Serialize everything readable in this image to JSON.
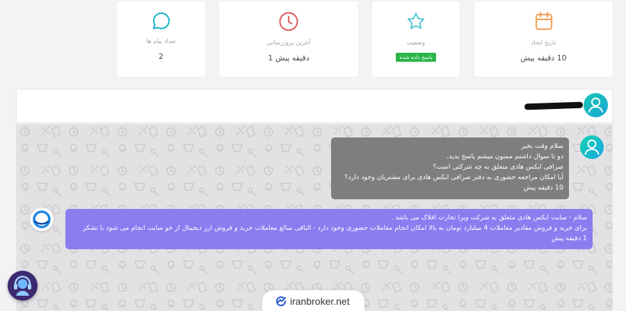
{
  "stats": [
    {
      "label": "تعداد پیام ها",
      "value": "2",
      "icon": "chat-bubble-icon",
      "color": "#22b7c9"
    },
    {
      "label": "آخرین بروزرسانی",
      "value": "دقیقه پیش 1",
      "icon": "clock-icon",
      "color": "#e06565"
    },
    {
      "label": "وضعیت",
      "badge": "پاسخ داده شده",
      "icon": "star-icon",
      "color": "#53c6d6",
      "badge_color": "#2bb44a"
    },
    {
      "label": "تاریخ ایجاد",
      "value": "10 دقیقه پیش",
      "icon": "calendar-icon",
      "color": "#f5a55c"
    }
  ],
  "messages": [
    {
      "sender": "user",
      "lines": [
        "سلام وقت بخیر",
        "دو تا سوال داشتم ممنون میشم پاسخ بدید.",
        "صرافی ایکس هادی متعلق به چه شرکتی است؟",
        "آیا امکان مراجعه حضوری به دفتر صرافی ایکس هادی برای مشتریان وجود دارد؟",
        "10 دقیقه پیش"
      ],
      "color": "#7e7e7e"
    },
    {
      "sender": "support",
      "lines": [
        "سلام - سایت ایکس هادی متعلق به شرکت ویرا تجارت افلاک می باشد .",
        "برای خرید و فروش مقادیر معاملات 4 میلیارد تومان به بالا امکان انجام معاملات حضوری وجود دارد - الباقی مبالغ معاملات خرید و فروش ارز دیجیتال از خو سایت انجام می شود با تشکر",
        "1 دقیقه پیش"
      ],
      "color": "#8a7df0"
    }
  ],
  "footer": {
    "brand": "iranbroker.net"
  }
}
